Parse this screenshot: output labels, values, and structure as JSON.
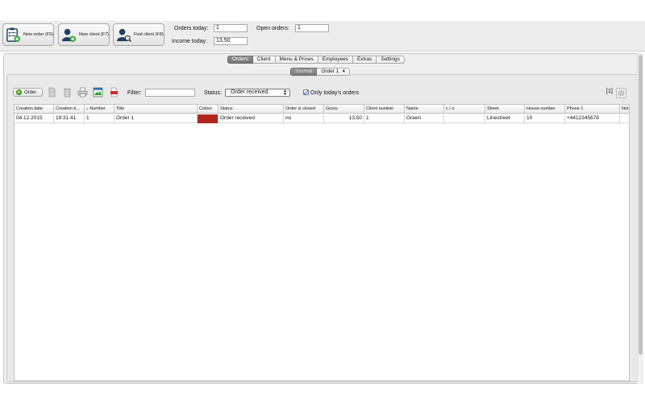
{
  "header": {
    "buttons": [
      {
        "label": "New order (F5)",
        "icon": "clipboard-list-icon"
      },
      {
        "label": "New client (F7)",
        "icon": "add-user-icon"
      },
      {
        "label": "Find client (F8)",
        "icon": "search-user-icon"
      }
    ],
    "orders_today_label": "Orders today:",
    "orders_today_value": "1",
    "open_orders_label": "Open orders:",
    "open_orders_value": "1",
    "income_today_label": "Income today:",
    "income_today_value": "13,50"
  },
  "main_tabs": [
    {
      "label": "Orders",
      "active": true
    },
    {
      "label": "Client",
      "active": false
    },
    {
      "label": "Menu & Prices",
      "active": false
    },
    {
      "label": "Employees",
      "active": false
    },
    {
      "label": "Extras",
      "active": false
    },
    {
      "label": "Settings",
      "active": false
    }
  ],
  "sub_tabs": {
    "journal": "Journal",
    "order": "Order 1",
    "close": "×"
  },
  "toolbar": {
    "order_button": "Order",
    "filter_label": "Filter:",
    "filter_value": "",
    "status_label": "Status:",
    "status_value": "Order received",
    "only_today_label": "Only today's orders",
    "only_today_checked": true,
    "count": "[1]"
  },
  "table": {
    "columns": [
      "Creation date",
      "Creation ti...",
      "↓ Number",
      "Title",
      "Colour",
      "Status",
      "Order is closed",
      "Gross",
      "Client number",
      "Name",
      "c / o",
      "Street",
      "House number",
      "Phone 1",
      "Not"
    ],
    "rows": [
      {
        "creation_date": "04.12.2015",
        "creation_time": "19:31:41",
        "number": "1",
        "title": "Order 1",
        "colour": "#b0261c",
        "status": "Order received",
        "closed": "no",
        "gross": "13,50",
        "client_number": "1",
        "name": "Green",
        "co": "",
        "street": "Linestreet",
        "house_number": "10",
        "phone": "+4412345678",
        "note": ""
      }
    ]
  }
}
